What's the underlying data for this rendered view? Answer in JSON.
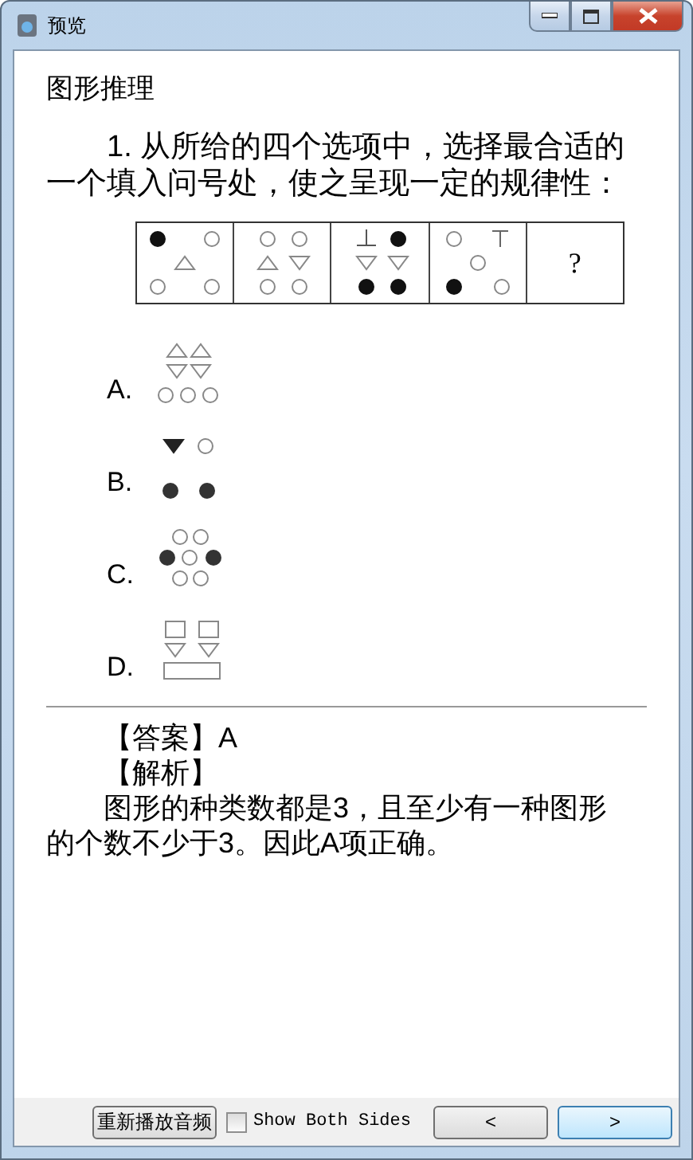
{
  "window": {
    "title": "预览"
  },
  "content": {
    "heading": "图形推理",
    "question": "1. 从所给的四个选项中，选择最合适的一个填入问号处，使之呈现一定的规律性：",
    "figure_cells": [
      {
        "kind": "figure"
      },
      {
        "kind": "figure"
      },
      {
        "kind": "figure"
      },
      {
        "kind": "figure"
      },
      {
        "kind": "question",
        "text": "?"
      }
    ],
    "options": [
      {
        "label": "A."
      },
      {
        "label": "B."
      },
      {
        "label": "C."
      },
      {
        "label": "D."
      }
    ],
    "answer": "【答案】A",
    "analysis_title": "【解析】",
    "analysis": "图形的种类数都是3，且至少有一种图形的个数不少于3。因此A项正确。"
  },
  "footer": {
    "replay_button": "重新播放音频",
    "show_both_sides": {
      "label": "Show Both Sides",
      "checked": false
    },
    "prev_button": "<",
    "next_button": ">"
  }
}
